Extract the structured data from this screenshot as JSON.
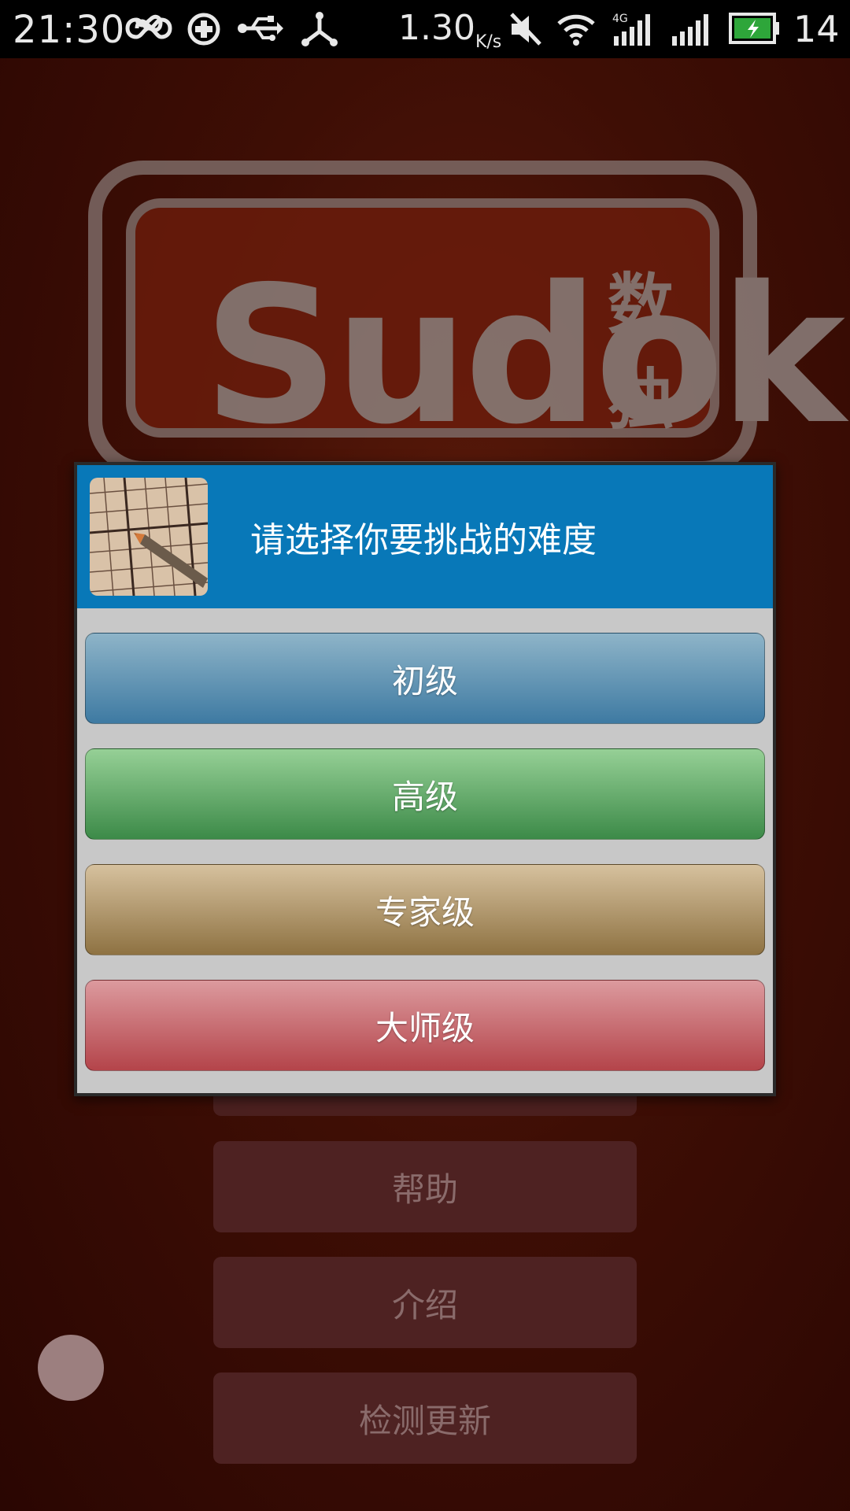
{
  "status_bar": {
    "time": "21:30",
    "speed_value": "1.30",
    "speed_unit": "K/s",
    "network_label": "4G",
    "battery_level": "14",
    "icons": [
      "infinity-icon",
      "sync-icon",
      "usb-icon",
      "share-icon",
      "mute-icon",
      "wifi-icon",
      "signal-4g-icon",
      "signal-icon",
      "battery-charging-icon"
    ]
  },
  "background": {
    "logo_text": "Sudoku",
    "logo_cn": "数独",
    "menu_items": [
      {
        "label": "帮助"
      },
      {
        "label": "介绍"
      },
      {
        "label": "检测更新"
      }
    ]
  },
  "dialog": {
    "title": "请选择你要挑战的难度",
    "levels": [
      {
        "label": "初级",
        "color": "#4a86ad"
      },
      {
        "label": "高级",
        "color": "#4c9a55"
      },
      {
        "label": "专家级",
        "color": "#a8895a"
      },
      {
        "label": "大师级",
        "color": "#c4585d"
      }
    ]
  },
  "colors": {
    "dialog_header": "#0878b8",
    "dialog_body": "#c8c8c8",
    "background": "#3e0e05"
  }
}
